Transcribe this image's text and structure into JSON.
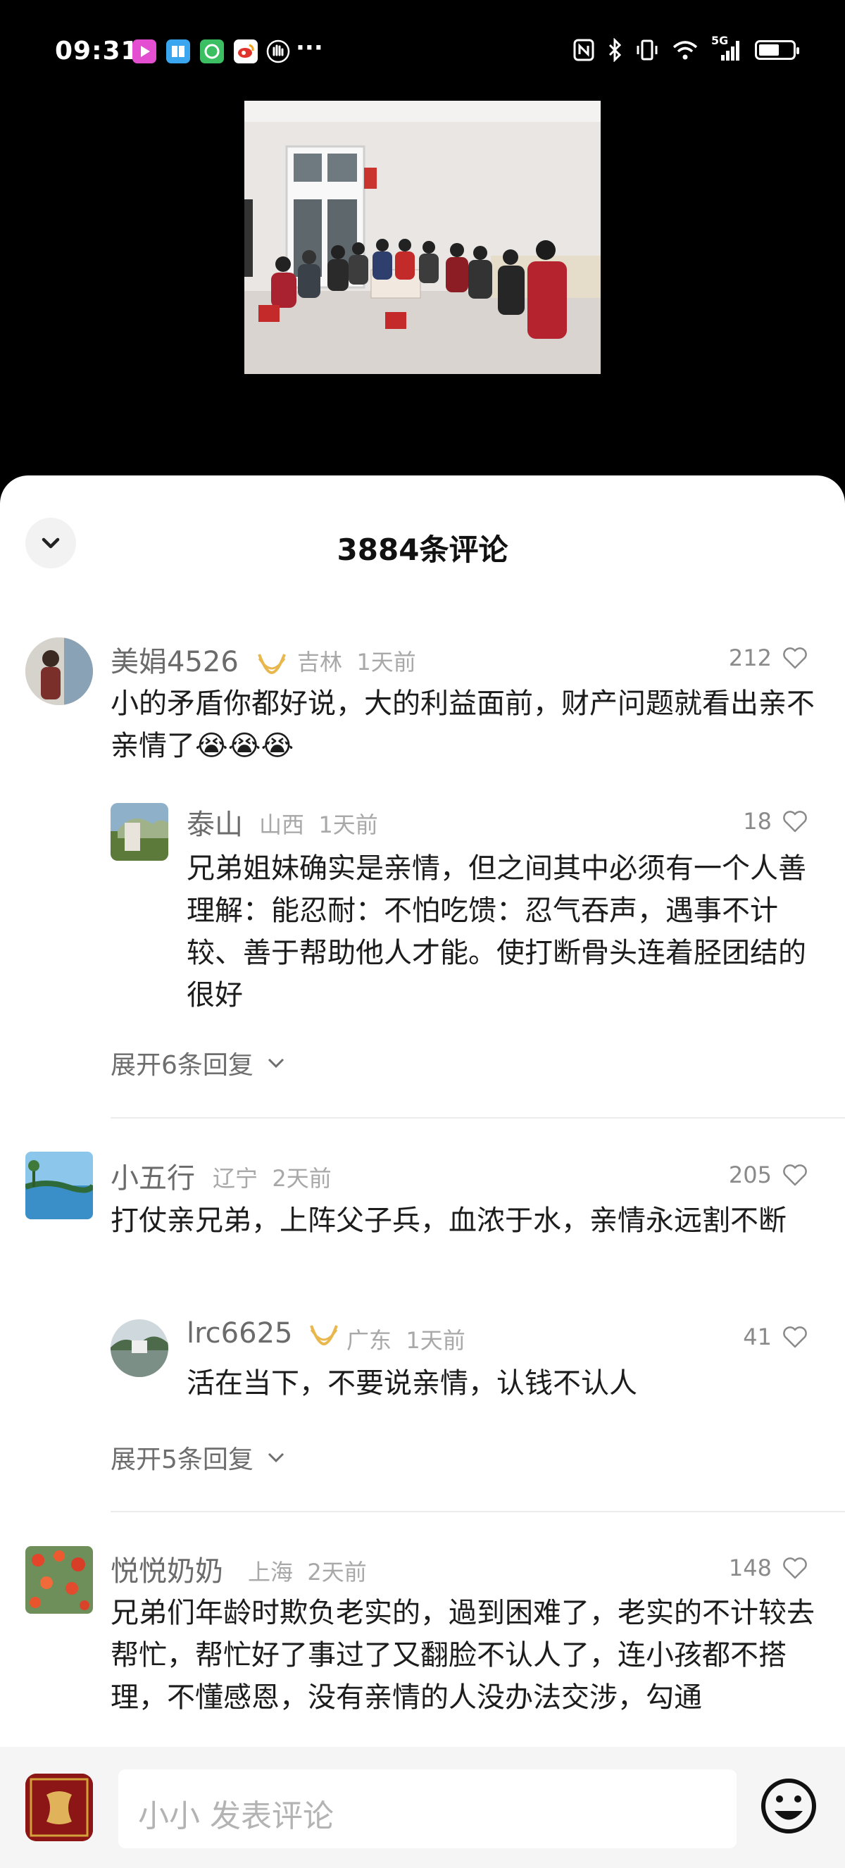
{
  "status_bar": {
    "time": "09:31",
    "network": "5G",
    "more": "···",
    "battery_level": 0.6,
    "icons": [
      "video-app-icon",
      "reader-app-icon",
      "refresh-app-icon",
      "weibo-app-icon",
      "hand-app-icon",
      "nfc-icon",
      "bluetooth-icon",
      "vibrate-icon",
      "wifi-icon",
      "signal-icon",
      "battery-icon"
    ]
  },
  "sheet": {
    "title": "3884条评论",
    "collapse_icon": "chevron-down-icon"
  },
  "comments": [
    {
      "username": "美娟4526",
      "has_badge": true,
      "location": "吉林",
      "time": "1天前",
      "likes": "212",
      "text": "小的矛盾你都好说，大的利益面前，财产问题就看出亲不亲情了😭😭😭",
      "reply": {
        "username": "泰山",
        "location": "山西",
        "time": "1天前",
        "likes": "18",
        "text": "兄弟姐妹确实是亲情，但之间其中必须有一个人善理解：能忍耐：不怕吃馈：忍气吞声，遇事不计较、善于帮助他人才能。使打断骨头连着胫团结的很好"
      },
      "expand": "展开6条回复"
    },
    {
      "username": "小五行",
      "location": "辽宁",
      "time": "2天前",
      "likes": "205",
      "text": "打仗亲兄弟，上阵父子兵，血浓于水，亲情永远割不断",
      "reply": {
        "username": "lrc6625",
        "has_badge": true,
        "location": "广东",
        "time": "1天前",
        "likes": "41",
        "text": "活在当下，不要说亲情，认钱不认人"
      },
      "expand": "展开5条回复"
    },
    {
      "username": "悦悦奶奶",
      "location": "上海",
      "time": "2天前",
      "likes": "148",
      "text": "兄弟们年龄时欺负老实的，過到困难了，老实的不计较去帮忙，帮忙好了事过了又翻脸不认人了，连小孩都不搭理，不懂感恩，没有亲情的人没办法交涉，勾通"
    }
  ],
  "bottom_bar": {
    "placeholder": "小小 发表评论",
    "emoji_icon": "smile-emoji-icon"
  },
  "colors": {
    "accent_badge": "#e8b74d",
    "text_muted": "#a8a8a8",
    "text_name": "#6b6b6b",
    "background": "#ffffff"
  }
}
